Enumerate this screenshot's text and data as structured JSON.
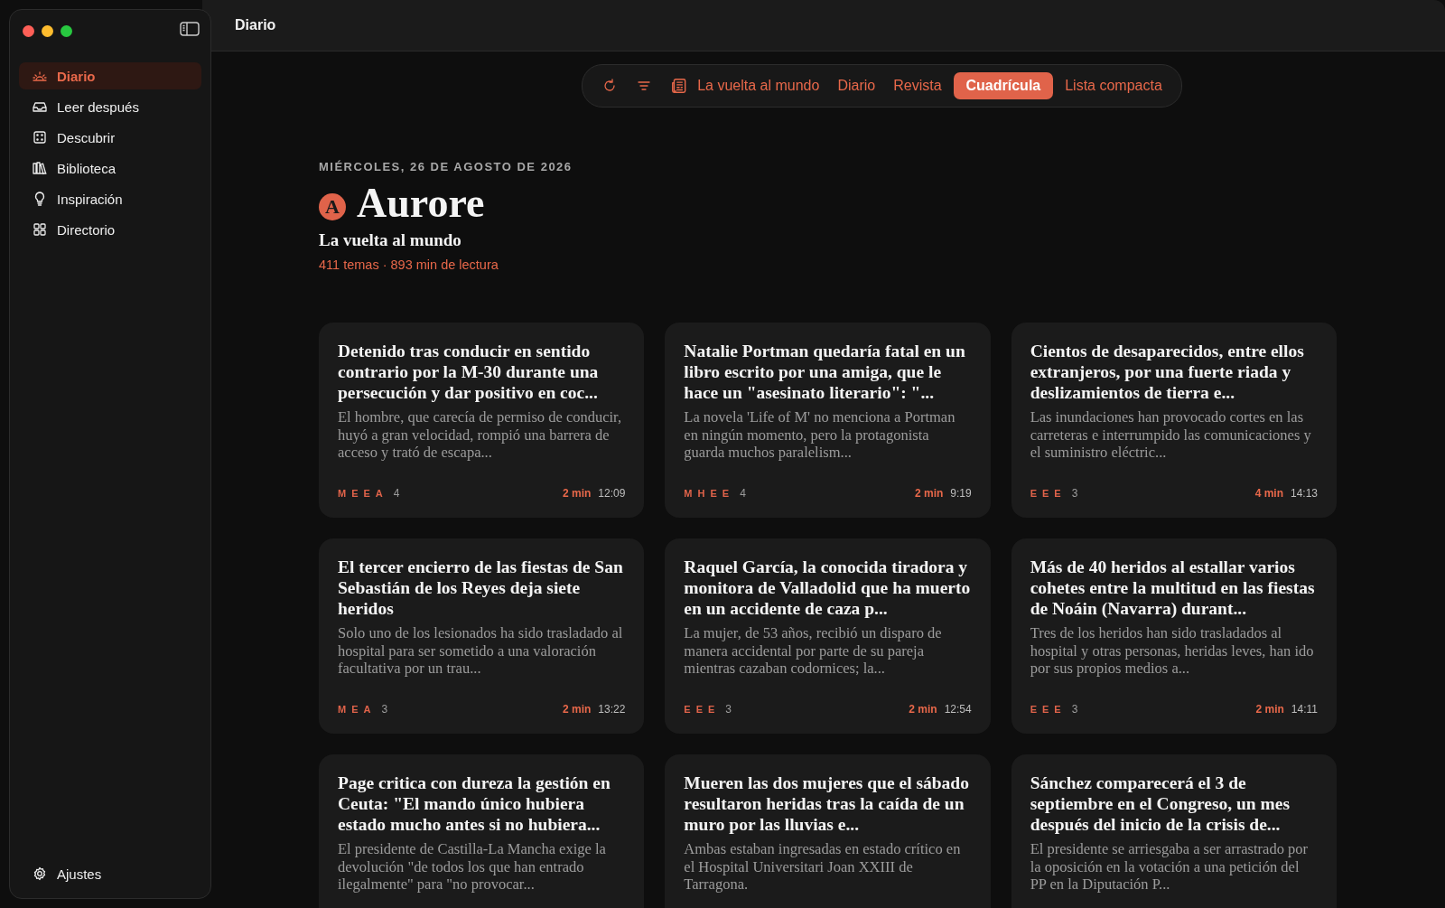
{
  "window": {
    "title": "Diario"
  },
  "sidebar": {
    "items": [
      {
        "label": "Diario",
        "selected": true
      },
      {
        "label": "Leer después",
        "selected": false
      },
      {
        "label": "Descubrir",
        "selected": false
      },
      {
        "label": "Biblioteca",
        "selected": false
      },
      {
        "label": "Inspiración",
        "selected": false
      },
      {
        "label": "Directorio",
        "selected": false
      }
    ],
    "footer": {
      "label": "Ajustes"
    }
  },
  "toolbar": {
    "feed": "La vuelta al mundo",
    "views": [
      {
        "label": "Diario",
        "selected": false
      },
      {
        "label": "Revista",
        "selected": false
      },
      {
        "label": "Cuadrícula",
        "selected": true
      },
      {
        "label": "Lista compacta",
        "selected": false
      }
    ]
  },
  "header": {
    "date": "MIÉRCOLES, 26 DE AGOSTO DE 2026",
    "logo_letter": "A",
    "brand": "Aurore",
    "feed": "La vuelta al mundo",
    "stats": "411 temas · 893 min de lectura"
  },
  "articles": [
    {
      "title": "Detenido tras conducir en sentido contrario por la M-30 durante una persecución y dar positivo en coc...",
      "summary": "El hombre, que carecía de permiso de conducir, huyó a gran velocidad, rompió una barrera de acceso y trató de escapa...",
      "sources": [
        "M",
        "E",
        "E",
        "A"
      ],
      "count": "4",
      "read_time": "2 min",
      "time": "12:09"
    },
    {
      "title": "Natalie Portman quedaría fatal en un libro escrito por una amiga, que le hace un \"asesinato literario\": \"...",
      "summary": "La novela 'Life of M' no menciona a Portman en ningún momento, pero la protagonista guarda muchos paralelism...",
      "sources": [
        "M",
        "H",
        "E",
        "E"
      ],
      "count": "4",
      "read_time": "2 min",
      "time": "9:19"
    },
    {
      "title": "Cientos de desaparecidos, entre ellos extranjeros, por una fuerte riada y deslizamientos de tierra e...",
      "summary": "Las inundaciones han provocado cortes en las carreteras e interrumpido las comunicaciones y el suministro eléctric...",
      "sources": [
        "E",
        "E",
        "E"
      ],
      "count": "3",
      "read_time": "4 min",
      "time": "14:13"
    },
    {
      "title": "El tercer encierro de las fiestas de San Sebastián de los Reyes deja siete heridos",
      "summary": "Solo uno de los lesionados ha sido trasladado al hospital para ser sometido a una valoración facultativa por un trau...",
      "sources": [
        "M",
        "E",
        "A"
      ],
      "count": "3",
      "read_time": "2 min",
      "time": "13:22"
    },
    {
      "title": "Raquel García, la conocida tiradora y monitora de Valladolid que ha muerto en un accidente de caza p...",
      "summary": "La mujer, de 53 años, recibió un disparo de manera accidental por parte de su pareja mientras cazaban codornices; la...",
      "sources": [
        "E",
        "E",
        "E"
      ],
      "count": "3",
      "read_time": "2 min",
      "time": "12:54"
    },
    {
      "title": "Más de 40 heridos al estallar varios cohetes entre la multitud en las fiestas de Noáin (Navarra) durant...",
      "summary": "Tres de los heridos han sido trasladados al hospital y otras personas, heridas leves, han ido por sus propios medios a...",
      "sources": [
        "E",
        "E",
        "E"
      ],
      "count": "3",
      "read_time": "2 min",
      "time": "14:11"
    },
    {
      "title": "Page critica con dureza la gestión en Ceuta: \"El mando único hubiera estado mucho antes si no hubiera...",
      "summary": "El presidente de Castilla-La Mancha exige la devolución \"de todos los que han entrado ilegalmente\" para \"no provocar..."
    },
    {
      "title": "Mueren las dos mujeres que el sábado resultaron heridas tras la caída de un muro por las lluvias e...",
      "summary": "Ambas estaban ingresadas en estado crítico en el Hospital Universitari Joan XXIII de Tarragona."
    },
    {
      "title": "Sánchez comparecerá el 3 de septiembre en el Congreso, un mes después del inicio de la crisis de...",
      "summary": "El presidente se arriesgaba a ser arrastrado por la oposición en la votación a una petición del PP en la Diputación P..."
    }
  ]
}
